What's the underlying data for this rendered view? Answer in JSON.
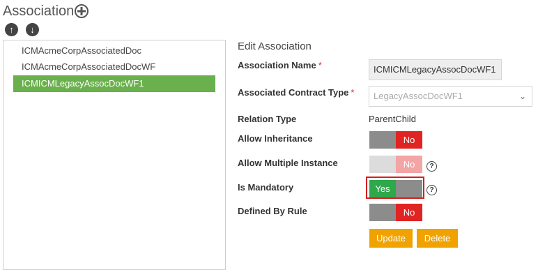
{
  "header": {
    "title": "Association",
    "add_icon": "plus-circle-icon",
    "up_glyph": "↑",
    "down_glyph": "↓"
  },
  "list": {
    "items": [
      {
        "label": "ICMAcmeCorpAssociatedDoc",
        "selected": false
      },
      {
        "label": "ICMAcmeCorpAssociatedDocWF",
        "selected": false
      },
      {
        "label": "ICMICMLegacyAssocDocWF1",
        "selected": true
      }
    ]
  },
  "form": {
    "title": "Edit Association",
    "association_name": {
      "label": "Association Name",
      "required_mark": "*",
      "value": "ICMICMLegacyAssocDocWF1"
    },
    "contract_type": {
      "label": "Associated Contract Type",
      "required_mark": "*",
      "value": "LegacyAssocDocWF1",
      "chevron": "⌄"
    },
    "relation_type": {
      "label": "Relation Type",
      "value": "ParentChild"
    },
    "allow_inheritance": {
      "label": "Allow Inheritance",
      "state_label": "No",
      "state": "off"
    },
    "allow_multiple": {
      "label": "Allow Multiple Instance",
      "state_label": "No",
      "state": "off",
      "disabled": true,
      "help": "?"
    },
    "is_mandatory": {
      "label": "Is Mandatory",
      "state_label": "Yes",
      "state": "on",
      "help": "?"
    },
    "defined_by_rule": {
      "label": "Defined By Rule",
      "state_label": "No",
      "state": "off"
    },
    "update_label": "Update",
    "delete_label": "Delete"
  },
  "colors": {
    "selected_item": "#6ab04c",
    "toggle_no": "#e02323",
    "toggle_yes": "#2ea84a",
    "toggle_knob": "#8c8c8c",
    "action_button": "#f0a200",
    "highlight_box": "#d42020",
    "required_mark": "#e03030"
  }
}
